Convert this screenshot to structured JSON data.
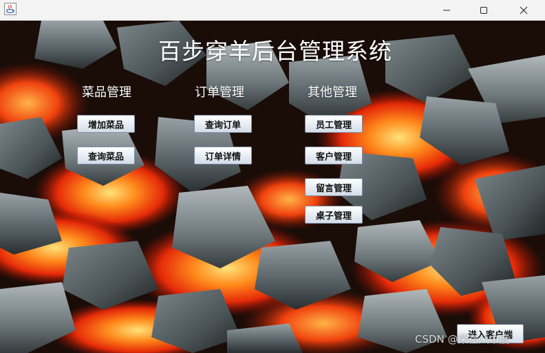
{
  "window": {
    "title": ""
  },
  "header": {
    "title": "百步穿羊后台管理系统"
  },
  "sections": {
    "dishes": {
      "label": "菜品管理",
      "buttons": [
        "增加菜品",
        "查询菜品"
      ]
    },
    "orders": {
      "label": "订单管理",
      "buttons": [
        "查询订单",
        "订单详情"
      ]
    },
    "others": {
      "label": "其他管理",
      "buttons": [
        "员工管理",
        "客户管理",
        "留言管理",
        "桌子管理"
      ]
    }
  },
  "client_button": "进入客户端",
  "watermark": "CSDN @荣在八中度",
  "colors": {
    "titlebar": "#f3f3f3",
    "button_border": "#7b8ea8",
    "text_light": "#ffffff"
  }
}
